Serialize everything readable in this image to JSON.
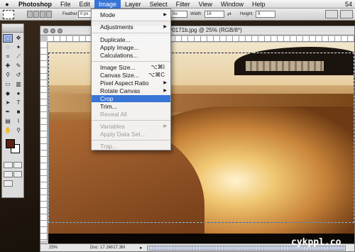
{
  "menubar": {
    "app": "Photoshop",
    "items": [
      "File",
      "Edit",
      "Image",
      "Layer",
      "Select",
      "Filter",
      "View",
      "Window",
      "Help"
    ],
    "active": "Image",
    "clock": "54"
  },
  "options_bar": {
    "feather_label": "Feather:",
    "feather_value": "0 px",
    "style_value": "ho",
    "width_label": "Width:",
    "width_value": "16",
    "height_label": "Height:",
    "height_value": "9"
  },
  "document": {
    "title": "P0171b.jpg @ 25% (RGB/8*)",
    "zoom": "25%",
    "doc_size": "Doc: 17.1M/17.3M"
  },
  "image_menu": {
    "mode": "Mode",
    "adjustments": "Adjustments",
    "duplicate": "Duplicate...",
    "apply_image": "Apply Image...",
    "calculations": "Calculations...",
    "image_size": "Image Size...",
    "image_size_sc": "⌥⌘I",
    "canvas_size": "Canvas Size...",
    "canvas_size_sc": "⌥⌘C",
    "pixel_aspect": "Pixel Aspect Ratio",
    "rotate_canvas": "Rotate Canvas",
    "crop": "Crop",
    "trim": "Trim...",
    "reveal_all": "Reveal All",
    "variables": "Variables",
    "apply_data_set": "Apply Data Set...",
    "trap": "Trap..."
  },
  "watermark": "cykppl.co",
  "colors": {
    "accent": "#3875d7",
    "foreground_swatch": "#5a1f10"
  }
}
